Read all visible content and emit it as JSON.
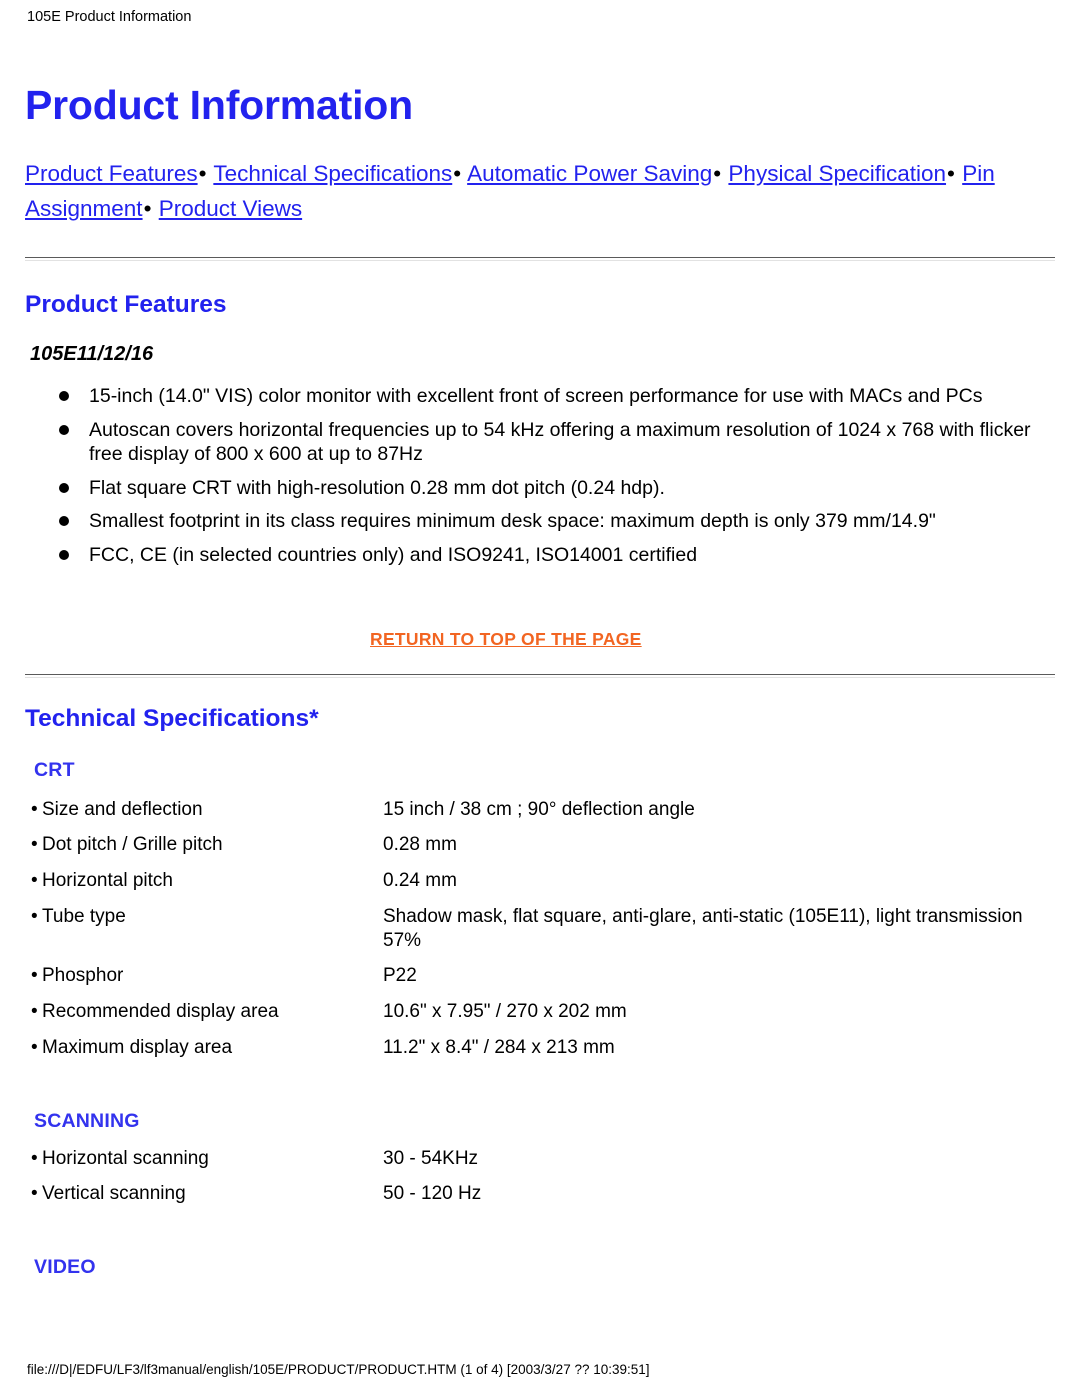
{
  "doc": {
    "header_title": "105E Product Information",
    "footer_text": "file:///D|/EDFU/LF3/lf3manual/english/105E/PRODUCT/PRODUCT.HTM (1 of 4) [2003/3/27 ?? 10:39:51]"
  },
  "colors": {
    "heading_blue": "#2222EE",
    "link_blue": "#2222EE",
    "return_orange": "#F26522",
    "text_black": "#000000",
    "rule_dark": "#5A5A5A",
    "rule_light": "#E2E2E2",
    "background": "#FFFFFF"
  },
  "page": {
    "title": "Product Information"
  },
  "nav": {
    "separator": "•",
    "links": [
      "Product Features",
      "Technical Specifications",
      "Automatic Power Saving",
      "Physical Specification",
      "Pin Assignment",
      "Product Views"
    ]
  },
  "product_features": {
    "heading": "Product Features",
    "model": "105E11/12/16",
    "bullets": [
      "15-inch (14.0\" VIS) color monitor with excellent front of screen performance for use with MACs and PCs",
      "Autoscan covers horizontal frequencies up to 54 kHz offering a maximum resolution of 1024 x 768 with flicker free display of 800 x 600 at up to 87Hz",
      "Flat square CRT with high-resolution 0.28 mm dot pitch (0.24 hdp).",
      "Smallest footprint in its class requires minimum desk space: maximum depth is only 379 mm/14.9\"",
      "FCC, CE (in selected countries only) and ISO9241, ISO14001 certified"
    ]
  },
  "return_to_top": {
    "label": "RETURN TO TOP OF THE PAGE"
  },
  "technical_specifications": {
    "heading": "Technical Specifications*",
    "bullet": "•",
    "sections": [
      {
        "name": "CRT",
        "rows": [
          {
            "label": "Size and deflection",
            "value": "15 inch / 38 cm ; 90° deflection angle"
          },
          {
            "label": "Dot pitch / Grille pitch",
            "value": "0.28 mm"
          },
          {
            "label": "Horizontal pitch",
            "value": "0.24 mm"
          },
          {
            "label": "Tube type",
            "value": "Shadow mask, flat square, anti-glare, anti-static (105E11), light transmission 57%"
          },
          {
            "label": "Phosphor",
            "value": "P22"
          },
          {
            "label": "Recommended display area",
            "value": "10.6\" x 7.95\" / 270 x 202 mm"
          },
          {
            "label": "Maximum display area",
            "value": "11.2\" x 8.4\" / 284 x 213 mm"
          }
        ]
      },
      {
        "name": "SCANNING",
        "rows": [
          {
            "label": "Horizontal scanning",
            "value": "30 - 54KHz"
          },
          {
            "label": "Vertical scanning",
            "value": "50 - 120 Hz"
          }
        ]
      },
      {
        "name": "VIDEO",
        "rows": []
      }
    ]
  }
}
